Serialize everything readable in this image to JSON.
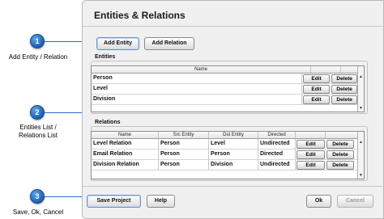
{
  "callouts": [
    {
      "number": "1",
      "label": "Add Entity / Relation"
    },
    {
      "number": "2",
      "label_line1": "Entities List /",
      "label_line2": "Relations List"
    },
    {
      "number": "3",
      "label": "Save, Ok, Cancel"
    }
  ],
  "dialog": {
    "title": "Entities & Relations",
    "toolbar": {
      "add_entity": "Add Entity",
      "add_relation": "Add Relation"
    },
    "entities": {
      "group_label": "Entities",
      "column_header": "Name",
      "rows": [
        {
          "name": "Person",
          "edit": "Edit",
          "delete": "Delete"
        },
        {
          "name": "Level",
          "edit": "Edit",
          "delete": "Delete"
        },
        {
          "name": "Division",
          "edit": "Edit",
          "delete": "Delete"
        }
      ]
    },
    "relations": {
      "group_label": "Relations",
      "columns": [
        "Name",
        "Src Entity",
        "Dst Entity",
        "Directed"
      ],
      "rows": [
        {
          "name": "Level Relation",
          "src": "Person",
          "dst": "Level",
          "directed": "Undirected",
          "edit": "Edit",
          "delete": "Delete"
        },
        {
          "name": "Email Relation",
          "src": "Person",
          "dst": "Person",
          "directed": "Directed",
          "edit": "Edit",
          "delete": "Delete"
        },
        {
          "name": "Division Relation",
          "src": "Person",
          "dst": "Division",
          "directed": "Undirected",
          "edit": "Edit",
          "delete": "Delete"
        }
      ]
    },
    "footer": {
      "save_project": "Save Project",
      "help": "Help",
      "ok": "Ok",
      "cancel": "Cancel"
    }
  }
}
